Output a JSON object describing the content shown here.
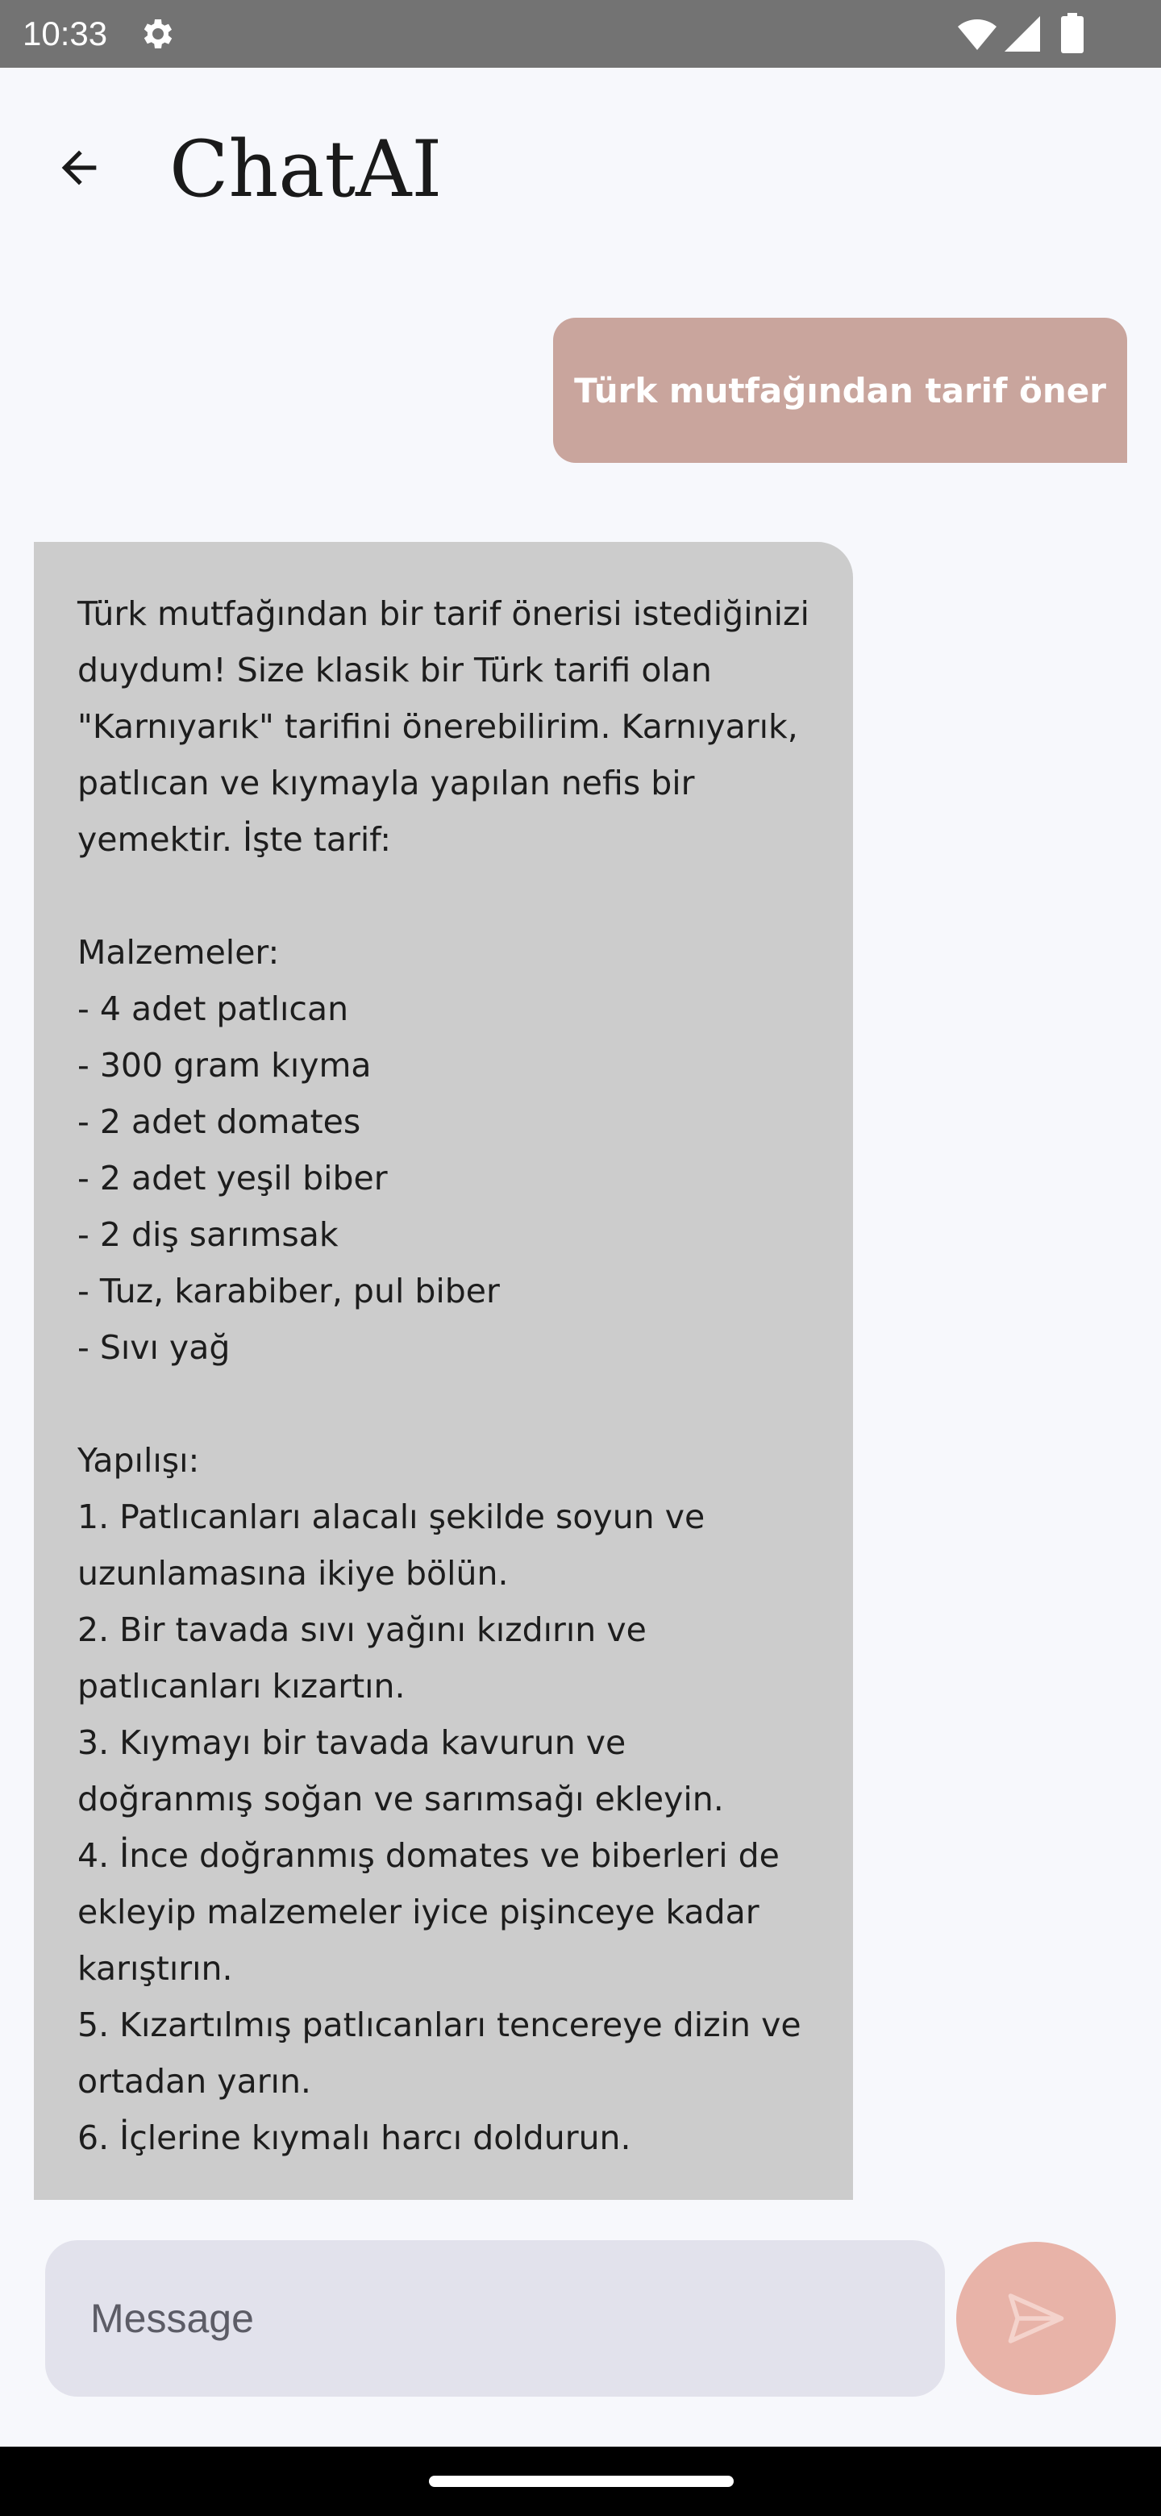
{
  "status_bar": {
    "time": "10:33",
    "icons": [
      "gear-icon",
      "wifi-icon",
      "signal-icon",
      "battery-icon"
    ]
  },
  "app_bar": {
    "title": "ChatAI",
    "back_icon": "arrow-back-icon"
  },
  "messages": [
    {
      "role": "user",
      "text": "Türk mutfağından tarif öner"
    },
    {
      "role": "assistant",
      "text": "Türk mutfağından bir tarif önerisi istediğinizi duydum! Size klasik bir Türk tarifi olan \"Karnıyarık\" tarifini önerebilirim. Karnıyarık, patlıcan ve kıymayla yapılan nefis bir yemektir. İşte tarif:\n\nMalzemeler:\n- 4 adet patlıcan\n- 300 gram kıyma\n- 2 adet domates\n- 2 adet yeşil biber\n- 2 diş sarımsak\n- Tuz, karabiber, pul biber\n- Sıvı yağ\n\nYapılışı:\n1. Patlıcanları alacalı şekilde soyun ve uzunlamasına ikiye bölün.\n2. Bir tavada sıvı yağını kızdırın ve patlıcanları kızartın.\n3. Kıymayı bir tavada kavurun ve doğranmış soğan ve sarımsağı ekleyin.\n4. İnce doğranmış domates ve biberleri de ekleyip malzemeler iyice pişinceye kadar karıştırın.\n5. Kızartılmış patlıcanları tencereye dizin ve ortadan yarın.\n6. İçlerine kıymalı harcı doldurun."
    }
  ],
  "composer": {
    "placeholder": "Message",
    "send_icon": "send-icon"
  },
  "colors": {
    "user_bubble": "#c9a59d",
    "assistant_bubble": "#cccccc",
    "send_button": "#e8b3a8",
    "input_background": "#e2e2ec",
    "background": "#f7f8fc"
  }
}
